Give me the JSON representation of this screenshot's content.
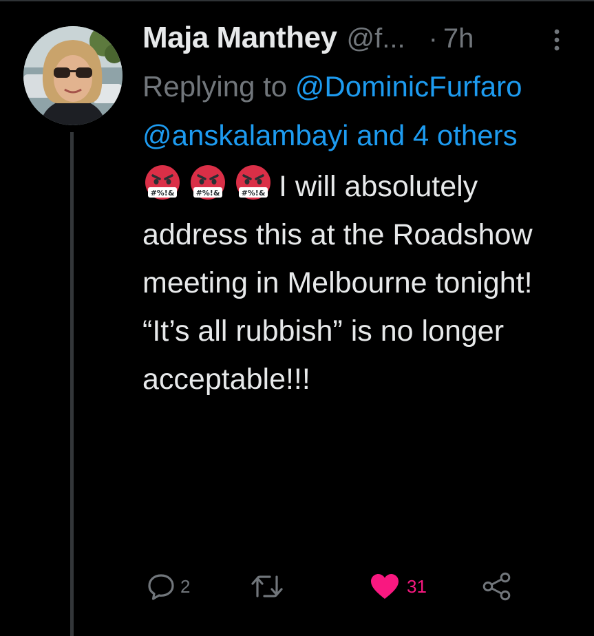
{
  "tweet": {
    "author": {
      "display_name": "Maja Manthey",
      "handle": "@f...",
      "avatar_icon": "profile-photo"
    },
    "separator": "·",
    "timestamp": "7h",
    "replying": {
      "prefix": "Replying to ",
      "mention_1": "@DominicFurfaro",
      "mention_2": "@anskalambayi",
      "and_text": " and ",
      "others_link": "4 others"
    },
    "emojis": [
      "face-with-symbols-on-mouth",
      "face-with-symbols-on-mouth",
      "face-with-symbols-on-mouth"
    ],
    "body": "I will absolutely address this at the Roadshow meeting in Melbourne tonight! “It’s all rubbish” is no longer acceptable!!!",
    "actions": {
      "reply_count": "2",
      "retweet_count": "",
      "like_count": "31"
    }
  },
  "colors": {
    "background": "#000000",
    "text": "#e7e9ea",
    "secondary": "#71767b",
    "link": "#1d9bf0",
    "like": "#f91880",
    "thread_line": "#333639"
  }
}
